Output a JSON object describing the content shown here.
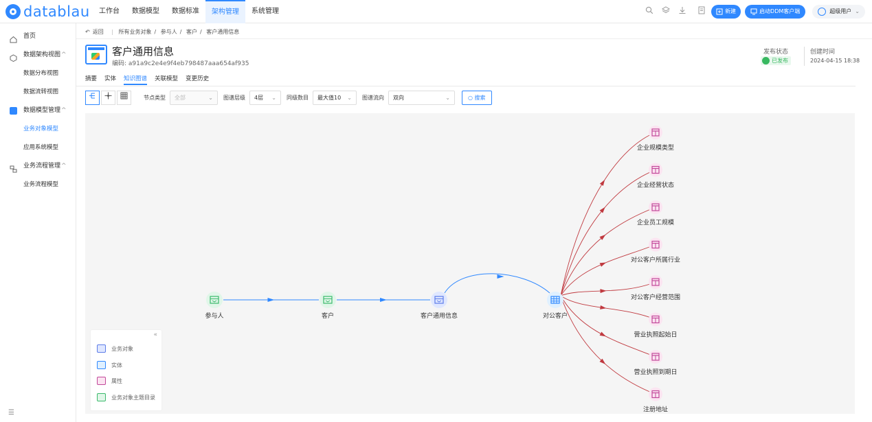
{
  "app": {
    "logo_text": "datablau",
    "nav_tabs": [
      {
        "label": "工作台",
        "active": false
      },
      {
        "label": "数据模型",
        "active": false
      },
      {
        "label": "数据标准",
        "active": false
      },
      {
        "label": "架构管理",
        "active": true
      },
      {
        "label": "系统管理",
        "active": false
      }
    ],
    "new_button": "新建",
    "ddm_button": "启动DDM客户端",
    "user_name": "超级用户",
    "brand_color": "#2f88ff"
  },
  "sidebar": {
    "items": [
      {
        "label": "首页",
        "icon": "home-icon",
        "level": 1
      },
      {
        "label": "数据架构视图",
        "icon": "cube-icon",
        "level": 1,
        "expanded": true
      },
      {
        "label": "数据分布视图",
        "level": 2
      },
      {
        "label": "数据流转视图",
        "level": 2
      },
      {
        "label": "数据模型管理",
        "icon": "model-icon",
        "level": 1,
        "expanded": true
      },
      {
        "label": "业务对象模型",
        "level": 2,
        "active": true
      },
      {
        "label": "应用系统模型",
        "level": 2
      },
      {
        "label": "业务流程管理",
        "icon": "process-icon",
        "level": 1,
        "expanded": true
      },
      {
        "label": "业务流程模型",
        "level": 2
      }
    ]
  },
  "breadcrumb": {
    "back": "返回",
    "sep": "|",
    "path": [
      "所有业务对象",
      "参与人",
      "客户",
      "客户通用信息"
    ]
  },
  "entity": {
    "title": "客户通用信息",
    "code_label": "编码:",
    "code": "a91a9c2e4e9f4eb798487aaa654af935",
    "publish_label": "发布状态",
    "publish_value": "已发布",
    "created_label": "创建时间",
    "created_value": "2024-04-15 18:38"
  },
  "tabs": [
    {
      "label": "摘要",
      "active": false
    },
    {
      "label": "实体",
      "active": false
    },
    {
      "label": "知识图谱",
      "active": true
    },
    {
      "label": "关联模型",
      "active": false
    },
    {
      "label": "变更历史",
      "active": false
    }
  ],
  "filters": {
    "node_type_label": "节点类型",
    "node_type_value": "全部",
    "level_label": "图谱层级",
    "level_value": "4层",
    "sibling_label": "同级数目",
    "sibling_value": "最大值10",
    "direction_label": "图谱流向",
    "direction_value": "双向",
    "search_button": "搜索"
  },
  "graph": {
    "main_nodes": [
      {
        "label": "参与人",
        "type": "topic"
      },
      {
        "label": "客户",
        "type": "topic"
      },
      {
        "label": "客户通用信息",
        "type": "business_object"
      },
      {
        "label": "对公客户",
        "type": "entity"
      }
    ],
    "attribute_nodes": [
      "企业规模类型",
      "企业经营状态",
      "企业员工规模",
      "对公客户所属行业",
      "对公客户经营范围",
      "营业执照起始日",
      "营业执照到期日",
      "注册地址"
    ],
    "colors": {
      "forward_edge": "#2f88ff",
      "attribute_edge": "#c0393f",
      "attribute_node": "#c2479a",
      "entity_node": "#2f88ff",
      "topic_node": "#39b96b"
    }
  },
  "legend": {
    "items": [
      {
        "label": "业务对象",
        "icon": "business-object-icon"
      },
      {
        "label": "实体",
        "icon": "entity-icon"
      },
      {
        "label": "属性",
        "icon": "attribute-icon"
      },
      {
        "label": "业务对象主题目录",
        "icon": "topic-icon"
      }
    ]
  }
}
